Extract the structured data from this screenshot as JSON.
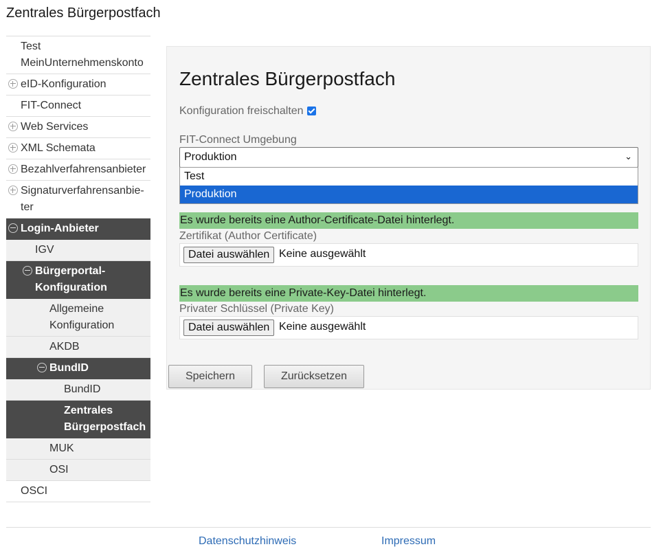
{
  "app": {
    "title": "Zentrales Bürgerpostfach"
  },
  "sidebar": {
    "items": [
      {
        "label": "Test MeinUnternehmenskonto"
      },
      {
        "label": "eID-Konfiguration"
      },
      {
        "label": "FIT-Connect"
      },
      {
        "label": "Web Services"
      },
      {
        "label": "XML Schemata"
      },
      {
        "label": "Bezahlverfahrensanbieter"
      },
      {
        "label": "Signaturverfahrensanbie­ter"
      },
      {
        "label": "Login-Anbieter"
      },
      {
        "label": "IGV"
      },
      {
        "label": "Bürgerportal-Konfiguration"
      },
      {
        "label": "Allgemeine Konfiguration"
      },
      {
        "label": "AKDB"
      },
      {
        "label": "BundID"
      },
      {
        "label": "BundID"
      },
      {
        "label": "Zentrales Bürgerpostfach"
      },
      {
        "label": "MUK"
      },
      {
        "label": "OSI"
      },
      {
        "label": "OSCI"
      }
    ]
  },
  "main": {
    "heading": "Zentrales Bürgerpostfach",
    "enable_label": "Konfiguration freischalten",
    "enable_checked": true,
    "env_label": "FIT-Connect Umgebung",
    "env_value": "Produktion",
    "env_options": [
      "Test",
      "Produktion"
    ],
    "author_cert_notice": "Es wurde bereits eine Author-Certificate-Datei hinterlegt.",
    "author_cert_label": "Zertifikat (Author Certificate)",
    "private_key_notice": "Es wurde bereits eine Private-Key-Datei hinterlegt.",
    "private_key_label": "Privater Schlüssel (Private Key)",
    "file_button": "Datei auswählen",
    "file_none": "Keine ausgewählt",
    "save_label": "Speichern",
    "reset_label": "Zurücksetzen"
  },
  "footer": {
    "privacy": "Datenschutzhinweis",
    "imprint": "Impressum"
  },
  "colors": {
    "selected_option": "#1967d2",
    "notice_bg": "#8bcb8b",
    "nav_active_bg": "#4a4a4a",
    "link": "#2d6bb5"
  }
}
